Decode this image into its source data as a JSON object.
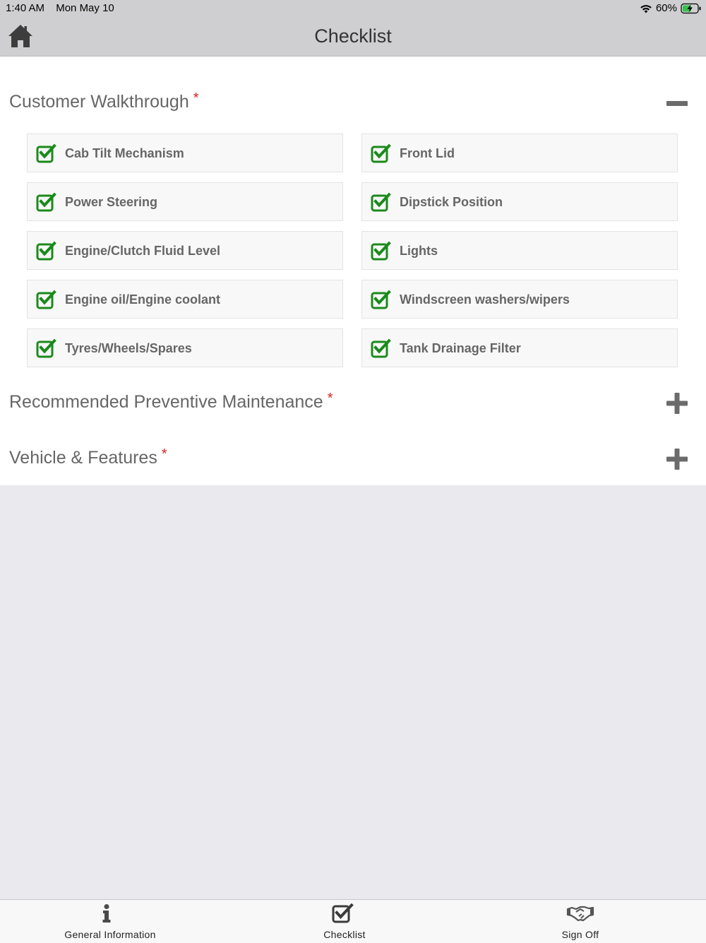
{
  "status": {
    "time": "1:40 AM",
    "date": "Mon May 10",
    "battery": "60%"
  },
  "header": {
    "title": "Checklist",
    "home_icon": "home-icon"
  },
  "colors": {
    "check": "#1a8a1a",
    "required": "#e02020",
    "text": "#666666",
    "bar": "#cfcfd1"
  },
  "sections": [
    {
      "title": "Customer Walkthrough",
      "required_mark": "*",
      "expanded": true,
      "items": [
        {
          "label": "Cab Tilt Mechanism",
          "checked": true
        },
        {
          "label": "Front Lid",
          "checked": true
        },
        {
          "label": "Power Steering",
          "checked": true
        },
        {
          "label": "Dipstick Position",
          "checked": true
        },
        {
          "label": "Engine/Clutch Fluid Level",
          "checked": true
        },
        {
          "label": "Lights",
          "checked": true
        },
        {
          "label": "Engine oil/Engine coolant",
          "checked": true
        },
        {
          "label": "Windscreen washers/wipers",
          "checked": true
        },
        {
          "label": "Tyres/Wheels/Spares",
          "checked": true
        },
        {
          "label": "Tank Drainage Filter",
          "checked": true
        }
      ]
    },
    {
      "title": "Recommended Preventive Maintenance",
      "required_mark": "*",
      "expanded": false
    },
    {
      "title": "Vehicle & Features",
      "required_mark": "*",
      "expanded": false
    }
  ],
  "tabs": [
    {
      "label": "General Information",
      "icon": "info-icon"
    },
    {
      "label": "Checklist",
      "icon": "checklist-icon"
    },
    {
      "label": "Sign Off",
      "icon": "handshake-icon"
    }
  ]
}
